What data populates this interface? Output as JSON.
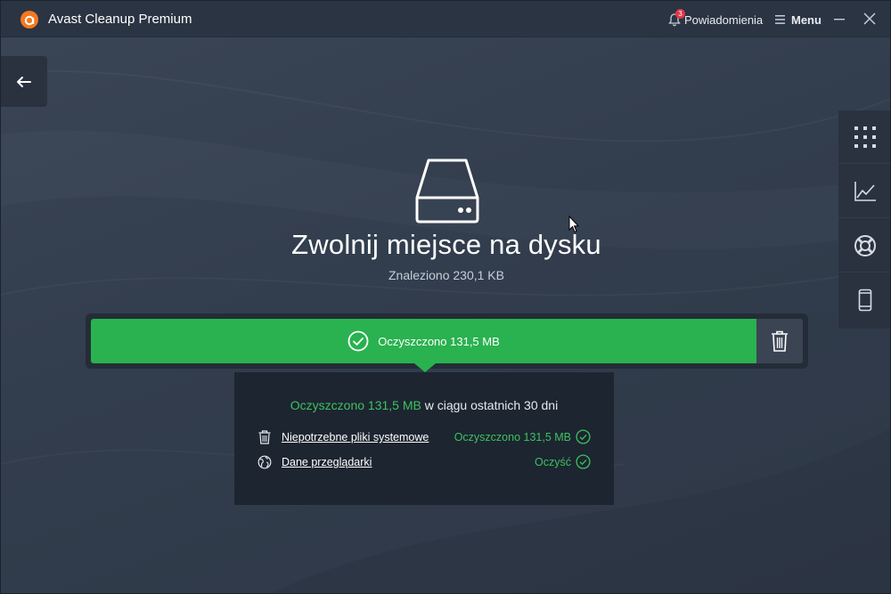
{
  "window": {
    "title": "Avast Cleanup Premium",
    "notifications_label": "Powiadomienia",
    "notifications_count": "3",
    "menu_label": "Menu"
  },
  "hero": {
    "title": "Zwolnij miejsce na dysku",
    "subtitle": "Znaleziono 230,1 KB",
    "icon": "hard-drive-icon"
  },
  "action": {
    "label": "Oczyszczono 131,5 MB",
    "status_color": "#29b24f"
  },
  "summary": {
    "amount": "Oczyszczono 131,5 MB",
    "period": " w ciągu ostatnich 30 dni",
    "items": [
      {
        "label": "Niepotrzebne pliki systemowe",
        "status": "Oczyszczono 131,5 MB",
        "icon": "trash-icon"
      },
      {
        "label": "Dane przeglądarki",
        "status": "Oczyść",
        "icon": "globe-icon"
      }
    ]
  },
  "sidebar": {
    "items": [
      {
        "icon": "grid-icon"
      },
      {
        "icon": "chart-icon"
      },
      {
        "icon": "lifebuoy-icon"
      },
      {
        "icon": "mobile-icon"
      }
    ]
  },
  "colors": {
    "accent_green": "#29b24f",
    "text_green": "#3cc161",
    "brand_orange": "#f47920",
    "background": "#333e4f"
  }
}
